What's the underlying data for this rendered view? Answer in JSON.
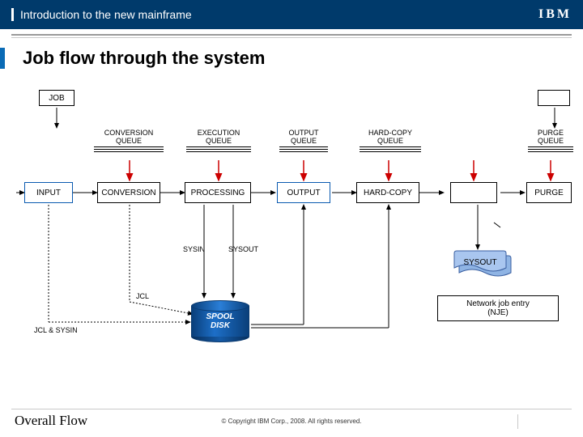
{
  "header": {
    "title": "Introduction to the new mainframe",
    "logo": "IBM"
  },
  "page": {
    "title": "Job flow through the system"
  },
  "diagram": {
    "job_box": "JOB",
    "queues": {
      "conversion": "CONVERSION\nQUEUE",
      "execution": "EXECUTION\nQUEUE",
      "output": "OUTPUT\nQUEUE",
      "hardcopy": "HARD-COPY\nQUEUE",
      "purge": "PURGE\nQUEUE"
    },
    "stages": {
      "input": "INPUT",
      "conversion": "CONVERSION",
      "processing": "PROCESSING",
      "output": "OUTPUT",
      "hardcopy": "HARD-COPY",
      "purge": "PURGE"
    },
    "labels": {
      "sysin": "SYSIN",
      "sysout": "SYSOUT",
      "jcl": "JCL",
      "jcl_sysin": "JCL & SYSIN"
    },
    "spool": "SPOOL\nDISK",
    "sysout_shape": "SYSOUT",
    "nje": "Network job entry\n(NJE)"
  },
  "footer": {
    "left": "Overall Flow",
    "copyright": "© Copyright IBM Corp., 2008. All rights reserved."
  }
}
